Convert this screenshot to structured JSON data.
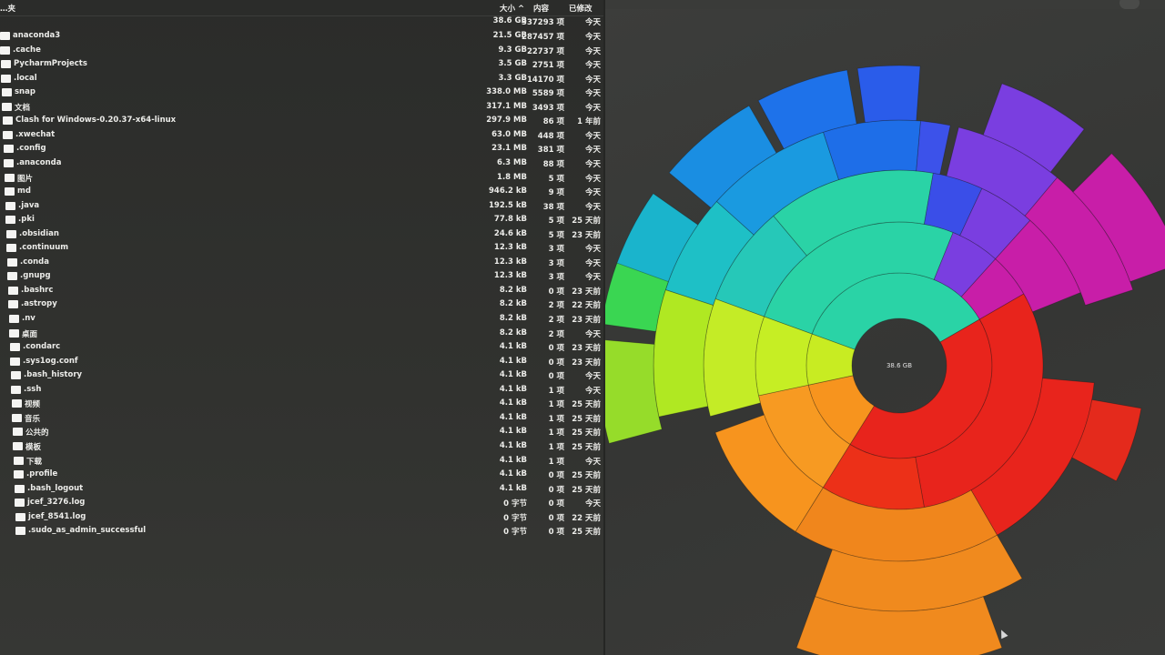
{
  "header": {
    "name_label": "…夹",
    "size_label": "大小 ^",
    "items_label": "内容",
    "modified_label": "已修改",
    "total_size": "38.6 GB",
    "total_items": "337293 项",
    "total_modified": "今天"
  },
  "rows": [
    {
      "name": "anaconda3",
      "size": "21.5 GB",
      "items": "287457 项",
      "modified": "今天"
    },
    {
      "name": ".cache",
      "size": "9.3 GB",
      "items": "22737 项",
      "modified": "今天"
    },
    {
      "name": "PycharmProjects",
      "size": "3.5 GB",
      "items": "2751 项",
      "modified": "今天"
    },
    {
      "name": ".local",
      "size": "3.3 GB",
      "items": "14170 项",
      "modified": "今天"
    },
    {
      "name": "snap",
      "size": "338.0 MB",
      "items": "5589 项",
      "modified": "今天"
    },
    {
      "name": "文档",
      "size": "317.1 MB",
      "items": "3493 项",
      "modified": "今天"
    },
    {
      "name": "Clash for Windows-0.20.37-x64-linux",
      "size": "297.9 MB",
      "items": "86 项",
      "modified": "1 年前"
    },
    {
      "name": ".xwechat",
      "size": "63.0 MB",
      "items": "448 项",
      "modified": "今天"
    },
    {
      "name": ".config",
      "size": "23.1 MB",
      "items": "381 项",
      "modified": "今天"
    },
    {
      "name": ".anaconda",
      "size": "6.3 MB",
      "items": "88 项",
      "modified": "今天"
    },
    {
      "name": "图片",
      "size": "1.8 MB",
      "items": "5 项",
      "modified": "今天"
    },
    {
      "name": "md",
      "size": "946.2 kB",
      "items": "9 项",
      "modified": "今天"
    },
    {
      "name": ".java",
      "size": "192.5 kB",
      "items": "38 项",
      "modified": "今天"
    },
    {
      "name": ".pki",
      "size": "77.8 kB",
      "items": "5 项",
      "modified": "25 天前"
    },
    {
      "name": ".obsidian",
      "size": "24.6 kB",
      "items": "5 项",
      "modified": "23 天前"
    },
    {
      "name": ".continuum",
      "size": "12.3 kB",
      "items": "3 项",
      "modified": "今天"
    },
    {
      "name": ".conda",
      "size": "12.3 kB",
      "items": "3 项",
      "modified": "今天"
    },
    {
      "name": ".gnupg",
      "size": "12.3 kB",
      "items": "3 项",
      "modified": "今天"
    },
    {
      "name": ".bashrc",
      "size": "8.2 kB",
      "items": "0 项",
      "modified": "23 天前"
    },
    {
      "name": ".astropy",
      "size": "8.2 kB",
      "items": "2 项",
      "modified": "22 天前"
    },
    {
      "name": ".nv",
      "size": "8.2 kB",
      "items": "2 项",
      "modified": "23 天前"
    },
    {
      "name": "桌面",
      "size": "8.2 kB",
      "items": "2 项",
      "modified": "今天"
    },
    {
      "name": ".condarc",
      "size": "4.1 kB",
      "items": "0 项",
      "modified": "23 天前"
    },
    {
      "name": ".sys1og.conf",
      "size": "4.1 kB",
      "items": "0 项",
      "modified": "23 天前"
    },
    {
      "name": ".bash_history",
      "size": "4.1 kB",
      "items": "0 项",
      "modified": "今天"
    },
    {
      "name": ".ssh",
      "size": "4.1 kB",
      "items": "1 项",
      "modified": "今天"
    },
    {
      "name": "视频",
      "size": "4.1 kB",
      "items": "1 项",
      "modified": "25 天前"
    },
    {
      "name": "音乐",
      "size": "4.1 kB",
      "items": "1 项",
      "modified": "25 天前"
    },
    {
      "name": "公共的",
      "size": "4.1 kB",
      "items": "1 项",
      "modified": "25 天前"
    },
    {
      "name": "模板",
      "size": "4.1 kB",
      "items": "1 项",
      "modified": "25 天前"
    },
    {
      "name": "下载",
      "size": "4.1 kB",
      "items": "1 项",
      "modified": "今天"
    },
    {
      "name": ".profile",
      "size": "4.1 kB",
      "items": "0 项",
      "modified": "25 天前"
    },
    {
      "name": ".bash_logout",
      "size": "4.1 kB",
      "items": "0 项",
      "modified": "25 天前"
    },
    {
      "name": "jcef_3276.log",
      "size": "0 字节",
      "items": "0 项",
      "modified": "今天"
    },
    {
      "name": "jcef_8541.log",
      "size": "0 字节",
      "items": "0 项",
      "modified": "22 天前"
    },
    {
      "name": ".sudo_as_admin_successful",
      "size": "0 字节",
      "items": "0 项",
      "modified": "25 天前"
    }
  ],
  "chart_data": {
    "type": "sunburst",
    "center_label": "38.6 GB",
    "ring1": [
      {
        "name": "anaconda3",
        "value": 21.5,
        "color": "#2ad3a6"
      },
      {
        "name": ".cache",
        "value": 9.3,
        "color": "#e8241c"
      },
      {
        "name": "PycharmProjects",
        "value": 3.5,
        "color": "#f7941e"
      },
      {
        "name": ".local",
        "value": 3.3,
        "color": "#c8ec22"
      }
    ]
  },
  "colors": {
    "anaconda3": "#2ad3a6",
    "cache": "#e8241c",
    "pycharm": "#f7941e",
    "local": "#c8ec22",
    "blue": "#1e78e6",
    "violet": "#7a3ee0",
    "magenta": "#c81ea8"
  }
}
